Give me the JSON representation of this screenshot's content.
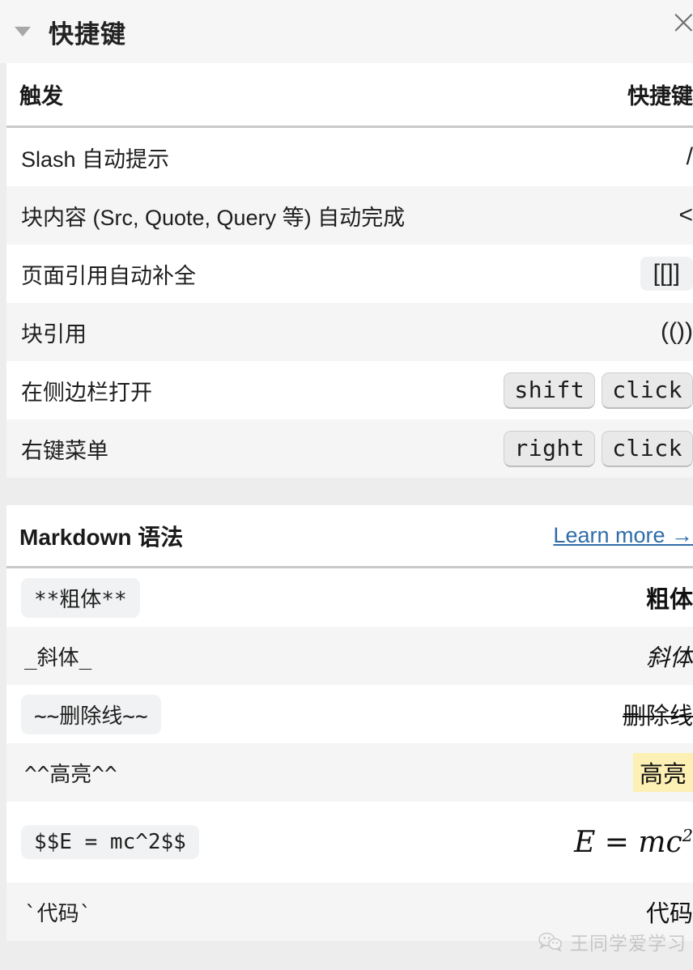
{
  "panel": {
    "title": "快捷键",
    "caret_icon": "triangle-down-icon",
    "close_icon": "close-icon"
  },
  "table": {
    "col_trigger": "触发",
    "col_shortcut": "快捷键",
    "rows": [
      {
        "trigger": "Slash 自动提示",
        "keys": [
          {
            "type": "plain",
            "text": "/"
          }
        ]
      },
      {
        "trigger": "块内容 (Src, Quote, Query 等) 自动完成",
        "keys": [
          {
            "type": "plain",
            "text": "<"
          }
        ]
      },
      {
        "trigger": "页面引用自动补全",
        "keys": [
          {
            "type": "box",
            "text": "[[]]"
          }
        ]
      },
      {
        "trigger": "块引用",
        "keys": [
          {
            "type": "plain",
            "text": "(())"
          }
        ]
      },
      {
        "trigger": "在侧边栏打开",
        "keys": [
          {
            "type": "kbd",
            "text": "shift"
          },
          {
            "type": "kbd",
            "text": "click"
          }
        ]
      },
      {
        "trigger": "右键菜单",
        "keys": [
          {
            "type": "kbd",
            "text": "right"
          },
          {
            "type": "kbd",
            "text": "click"
          }
        ]
      }
    ]
  },
  "markdown": {
    "title": "Markdown 语法",
    "learn_more": "Learn more →",
    "rows": [
      {
        "source": "**粗体**",
        "boxed": true,
        "output": "粗体",
        "style": "bold"
      },
      {
        "source": "_斜体_",
        "boxed": false,
        "output": "斜体",
        "style": "italic"
      },
      {
        "source": "~~删除线~~",
        "boxed": true,
        "output": "删除线",
        "style": "strike"
      },
      {
        "source": "^^高亮^^",
        "boxed": false,
        "output": "高亮",
        "style": "highlight"
      },
      {
        "source": "$$E = mc^2$$",
        "boxed": true,
        "output": "E = mc",
        "style": "formula",
        "sup": "2"
      },
      {
        "source": "`代码`",
        "boxed": false,
        "output": "代码",
        "style": "code"
      }
    ]
  },
  "watermark": {
    "text": "王同学爱学习",
    "icon": "wechat-icon"
  }
}
